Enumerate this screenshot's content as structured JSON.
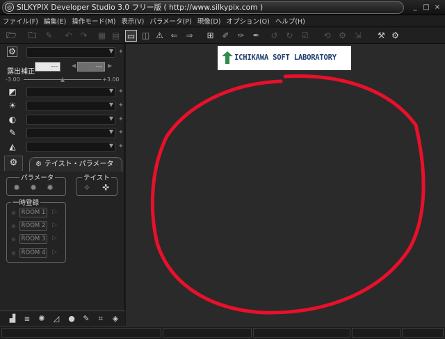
{
  "window": {
    "title": "SILKYPIX Developer Studio 3.0 フリー版 ( http://www.silkypix.com )",
    "controls": [
      "_",
      "□",
      "×"
    ]
  },
  "menu": [
    "ファイル(F)",
    "編集(E)",
    "操作モード(M)",
    "表示(V)",
    "パラメータ(P)",
    "現像(D)",
    "オプション(O)",
    "ヘルプ(H)"
  ],
  "panel": {
    "exposure_label": "露出補正",
    "exposure_value": "---",
    "exposure_step": "---",
    "scale_min": "-3.00",
    "scale_max": "+3.00",
    "exposure_level": 0.5,
    "tab_label": "テイスト・パラメータ",
    "param_group": "パラメータ",
    "taste_group": "テイスト",
    "memory_group": "一時登録",
    "rooms": [
      "ROOM 1",
      "ROOM 2",
      "ROOM 3",
      "ROOM 4"
    ]
  },
  "canvas": {
    "logo": "ICHIKAWA SOFT LABORATORY",
    "annotation_color": "#e8102a"
  }
}
